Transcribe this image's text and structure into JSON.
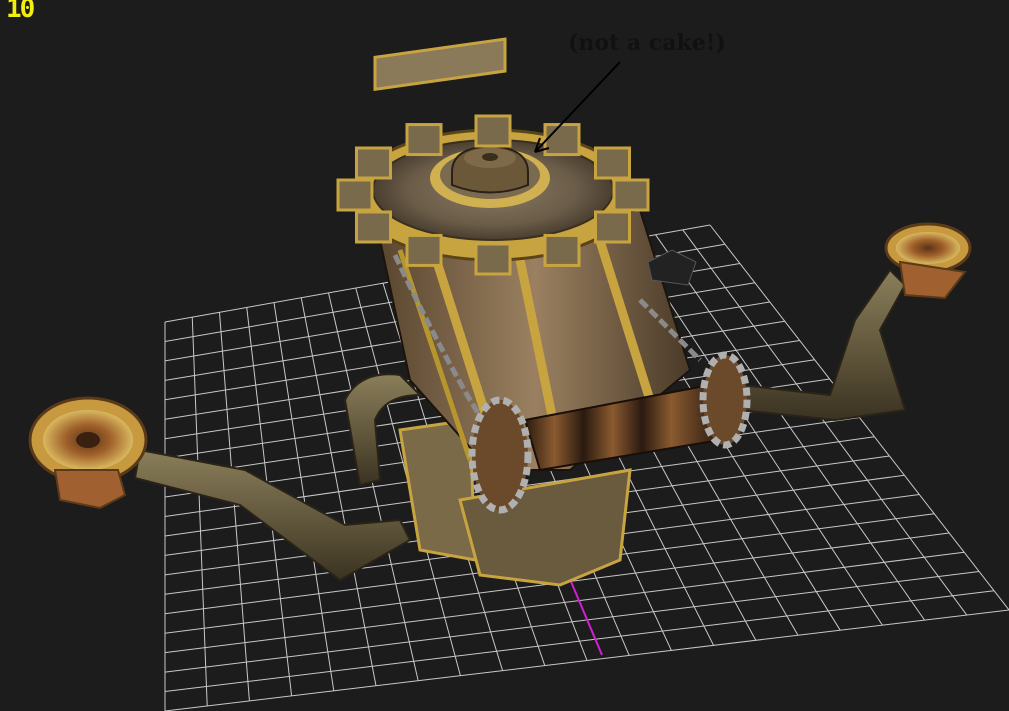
{
  "viewport": {
    "fps_counter": "10",
    "annotation": "(not a cake!)",
    "model": "steam-powered war machine with central gear tower, chained hubs and two pipe arms ending in gear wheels",
    "icons": [
      "fps-counter",
      "annotation-arrow",
      "ground-grid",
      "axis-line"
    ]
  },
  "colors": {
    "background": "#1c1c1c",
    "grid": "#c8c8c8",
    "fps": "#f2ee10",
    "axis": "#d020d0",
    "brass": "#b8962e",
    "wood": "#8a7050",
    "pipe": "#6a6045"
  }
}
